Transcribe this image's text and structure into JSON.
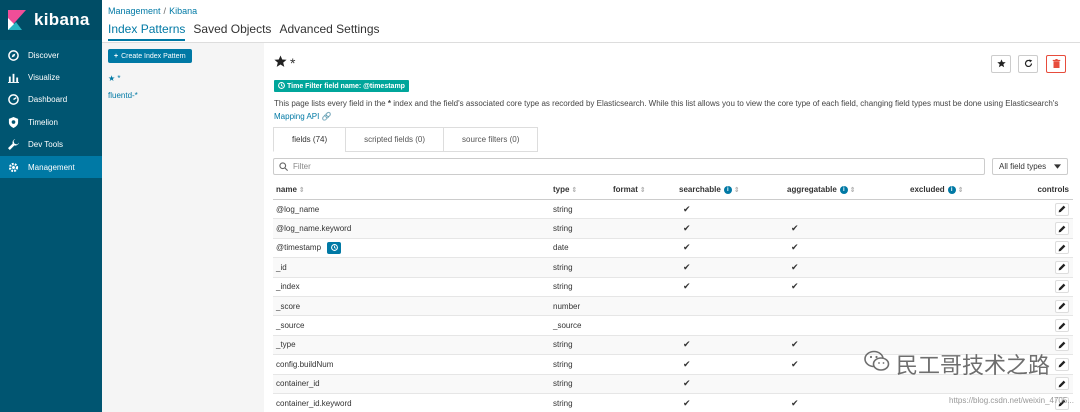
{
  "brand": {
    "name": "kibana"
  },
  "sidebar": {
    "items": [
      {
        "label": "Discover",
        "icon": "compass-icon"
      },
      {
        "label": "Visualize",
        "icon": "bar-chart-icon"
      },
      {
        "label": "Dashboard",
        "icon": "dashboard-icon"
      },
      {
        "label": "Timelion",
        "icon": "shield-icon"
      },
      {
        "label": "Dev Tools",
        "icon": "wrench-icon"
      },
      {
        "label": "Management",
        "icon": "gear-icon",
        "active": true
      }
    ]
  },
  "breadcrumb": {
    "root": "Management",
    "separator": "/",
    "current": "Kibana"
  },
  "tabs": [
    "Index Patterns",
    "Saved Objects",
    "Advanced Settings"
  ],
  "left": {
    "create_label": "Create Index Pattern",
    "patterns": [
      "★ *",
      "fluentd-*"
    ]
  },
  "main": {
    "title": "*",
    "time_filter_badge": "Time Filter field name: @timestamp",
    "description_1": "This page lists every field in the ",
    "description_bold": "*",
    "description_2": " index and the field's associated core type as recorded by Elasticsearch. While this list allows you to view the core type of each field, changing field types must be done using Elasticsearch's ",
    "mapping_link": "Mapping API",
    "field_tabs": [
      "fields (74)",
      "scripted fields (0)",
      "source filters (0)"
    ],
    "filter_placeholder": "Filter",
    "type_select": "All field types"
  },
  "table": {
    "headers": {
      "name": "name",
      "type": "type",
      "format": "format",
      "searchable": "searchable",
      "aggregatable": "aggregatable",
      "excluded": "excluded",
      "controls": "controls"
    },
    "rows": [
      {
        "name": "@log_name",
        "type": "string",
        "searchable": true,
        "aggregatable": false
      },
      {
        "name": "@log_name.keyword",
        "type": "string",
        "searchable": true,
        "aggregatable": true
      },
      {
        "name": "@timestamp",
        "type": "date",
        "searchable": true,
        "aggregatable": true,
        "time_field": true
      },
      {
        "name": "_id",
        "type": "string",
        "searchable": true,
        "aggregatable": true
      },
      {
        "name": "_index",
        "type": "string",
        "searchable": true,
        "aggregatable": true
      },
      {
        "name": "_score",
        "type": "number",
        "searchable": false,
        "aggregatable": false
      },
      {
        "name": "_source",
        "type": "_source",
        "searchable": false,
        "aggregatable": false
      },
      {
        "name": "_type",
        "type": "string",
        "searchable": true,
        "aggregatable": true
      },
      {
        "name": "config.buildNum",
        "type": "string",
        "searchable": true,
        "aggregatable": true
      },
      {
        "name": "container_id",
        "type": "string",
        "searchable": true,
        "aggregatable": false
      },
      {
        "name": "container_id.keyword",
        "type": "string",
        "searchable": true,
        "aggregatable": true
      }
    ]
  },
  "watermark": {
    "text": "民工哥技术之路",
    "url": "https://blog.csdn.net/weixin_4705..."
  },
  "colors": {
    "sidebar": "#005571",
    "accent": "#0079a5",
    "badge": "#00a69b",
    "danger": "#e74c3c"
  }
}
